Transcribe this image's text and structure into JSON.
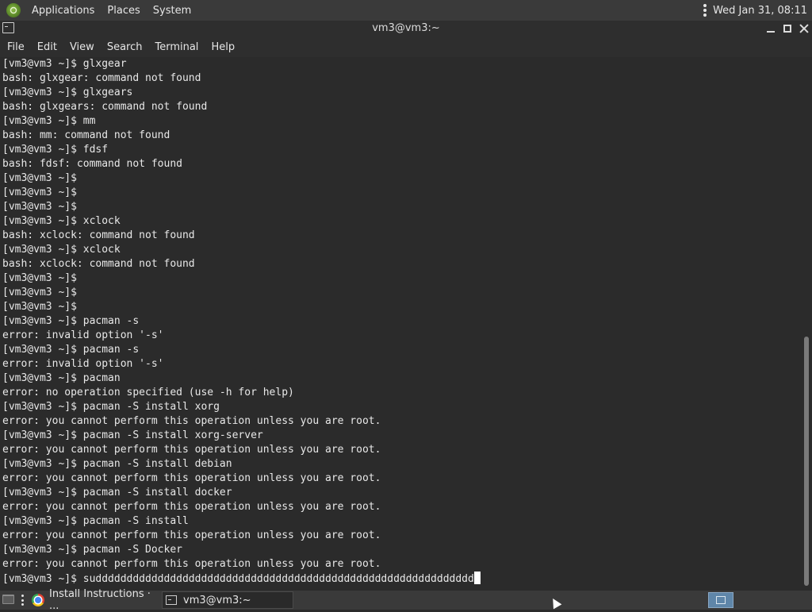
{
  "top_panel": {
    "menus": [
      "Applications",
      "Places",
      "System"
    ],
    "clock": "Wed Jan 31, 08:11"
  },
  "window": {
    "title": "vm3@vm3:~"
  },
  "menubar": {
    "items": [
      "File",
      "Edit",
      "View",
      "Search",
      "Terminal",
      "Help"
    ]
  },
  "terminal": {
    "lines": [
      "[vm3@vm3 ~]$ glxgear",
      "bash: glxgear: command not found",
      "[vm3@vm3 ~]$ glxgears",
      "bash: glxgears: command not found",
      "[vm3@vm3 ~]$ mm",
      "bash: mm: command not found",
      "[vm3@vm3 ~]$ fdsf",
      "bash: fdsf: command not found",
      "[vm3@vm3 ~]$",
      "[vm3@vm3 ~]$",
      "[vm3@vm3 ~]$",
      "[vm3@vm3 ~]$ xclock",
      "bash: xclock: command not found",
      "[vm3@vm3 ~]$ xclock",
      "bash: xclock: command not found",
      "[vm3@vm3 ~]$",
      "[vm3@vm3 ~]$",
      "[vm3@vm3 ~]$",
      "[vm3@vm3 ~]$ pacman -s",
      "error: invalid option '-s'",
      "[vm3@vm3 ~]$ pacman -s",
      "error: invalid option '-s'",
      "[vm3@vm3 ~]$ pacman",
      "error: no operation specified (use -h for help)",
      "[vm3@vm3 ~]$ pacman -S install xorg",
      "error: you cannot perform this operation unless you are root.",
      "[vm3@vm3 ~]$ pacman -S install xorg-server",
      "error: you cannot perform this operation unless you are root.",
      "[vm3@vm3 ~]$ pacman -S install debian",
      "error: you cannot perform this operation unless you are root.",
      "[vm3@vm3 ~]$ pacman -S install docker",
      "error: you cannot perform this operation unless you are root.",
      "[vm3@vm3 ~]$ pacman -S install",
      "error: you cannot perform this operation unless you are root.",
      "[vm3@vm3 ~]$ pacman -S Docker",
      "error: you cannot perform this operation unless you are root."
    ],
    "current_prompt": "[vm3@vm3 ~]$ suddddddddddddddddddddddddddddddddddddddddddddddddddddddddddddd"
  },
  "taskbar": {
    "tasks": [
      {
        "label": "Install Instructions · ...",
        "icon": "chrome-icon"
      },
      {
        "label": "vm3@vm3:~",
        "icon": "terminal-icon"
      }
    ]
  }
}
